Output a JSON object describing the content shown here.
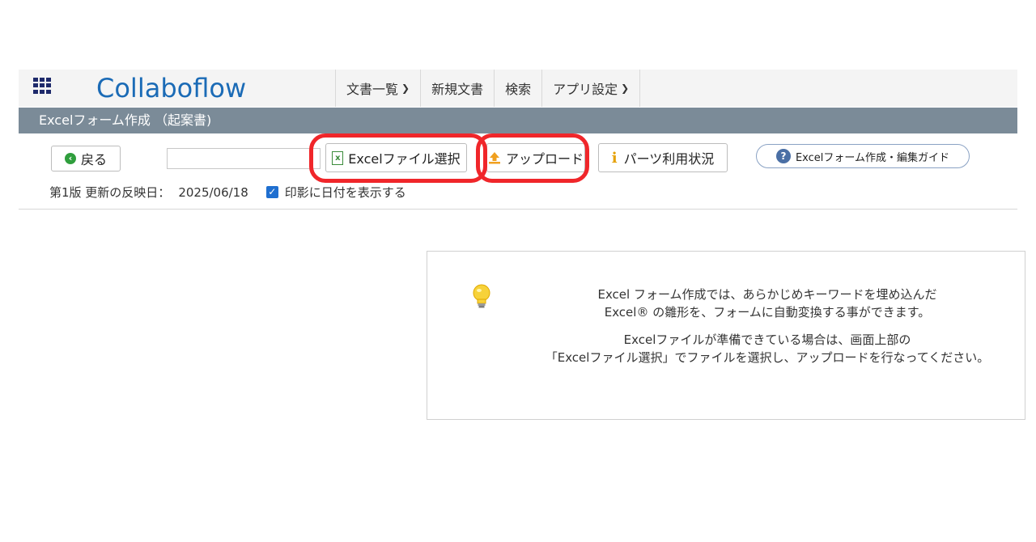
{
  "header": {
    "logo_text": "Collaboflow",
    "nav": [
      {
        "label": "文書一覧",
        "has_dropdown": true
      },
      {
        "label": "新規文書",
        "has_dropdown": false
      },
      {
        "label": "検索",
        "has_dropdown": false
      },
      {
        "label": "アプリ設定",
        "has_dropdown": true
      }
    ]
  },
  "title_bar": {
    "title": "Excelフォーム作成 （起案書)"
  },
  "toolbar": {
    "back_label": "戻る",
    "field_value": "",
    "excel_select_label": "Excelファイル選択",
    "upload_label": "アップロード",
    "parts_usage_label": "パーツ利用状況",
    "guide_label": "Excelフォーム作成・編集ガイド"
  },
  "meta": {
    "version_label": "第1版 更新の反映日：",
    "date": "2025/06/18",
    "stamp_date_checked": true,
    "stamp_date_label": "印影に日付を表示する"
  },
  "info": {
    "line1": "Excel フォーム作成では、あらかじめキーワードを埋め込んだ",
    "line2": "Excel® の雛形を、フォームに自動変換する事ができます。",
    "line3": "Excelファイルが準備できている場合は、画面上部の",
    "line4": "「Excelファイル選択」でファイルを選択し、アップロードを行なってください。"
  },
  "colors": {
    "title_bar": "#7b8b98",
    "highlight": "#f0262a",
    "brand": "#1b6bb6",
    "checkbox": "#1f6fd0"
  },
  "icons": [
    "apps-grid-icon",
    "back-arrow-icon",
    "excel-file-icon",
    "upload-icon",
    "info-icon",
    "help-icon",
    "lightbulb-icon",
    "chevron-down-icon",
    "checkbox-icon"
  ]
}
